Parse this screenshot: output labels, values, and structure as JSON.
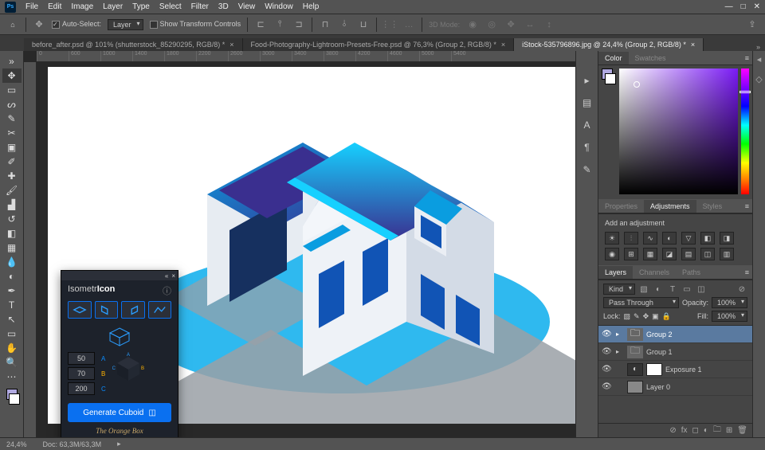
{
  "app": {
    "logo": "Ps"
  },
  "menu": [
    "File",
    "Edit",
    "Image",
    "Layer",
    "Type",
    "Select",
    "Filter",
    "3D",
    "View",
    "Window",
    "Help"
  ],
  "options": {
    "auto_select": "Auto-Select:",
    "auto_select_mode": "Layer",
    "show_transform": "Show Transform Controls",
    "mode_3d": "3D Mode:"
  },
  "tabs": [
    {
      "label": "before_after.psd @ 101% (shutterstock_85290295, RGB/8) *",
      "active": false
    },
    {
      "label": "Food-Photography-Lightroom-Presets-Free.psd @ 76,3% (Group 2, RGB/8) *",
      "active": false
    },
    {
      "label": "iStock-535796896.jpg @ 24,4% (Group 2, RGB/8) *",
      "active": true
    }
  ],
  "ruler": [
    "0",
    "600",
    "1000",
    "1400",
    "1800",
    "2200",
    "2600",
    "3000",
    "3400",
    "3800",
    "4200",
    "4600",
    "5000",
    "5400"
  ],
  "plugin": {
    "title_pre": "Isometr",
    "title_bold": "Icon",
    "vals": {
      "a": "50",
      "b": "70",
      "c": "200"
    },
    "axes": {
      "a": "A",
      "b": "B",
      "c": "C"
    },
    "generate": "Generate Cuboid",
    "signature": "The Orange Box"
  },
  "colorpanel": {
    "tab_color": "Color",
    "tab_swatches": "Swatches"
  },
  "adjustments": {
    "tab_props": "Properties",
    "tab_adj": "Adjustments",
    "tab_styles": "Styles",
    "label": "Add an adjustment"
  },
  "layerspanel": {
    "tab_layers": "Layers",
    "tab_channels": "Channels",
    "tab_paths": "Paths",
    "kind": "Kind",
    "blend": "Pass Through",
    "opacity_label": "Opacity:",
    "opacity": "100%",
    "lock_label": "Lock:",
    "fill_label": "Fill:",
    "fill": "100%",
    "rows": [
      {
        "name": "Group 2",
        "type": "folder",
        "selected": true
      },
      {
        "name": "Group 1",
        "type": "folder",
        "selected": false
      },
      {
        "name": "Exposure 1",
        "type": "adjustment",
        "selected": false
      },
      {
        "name": "Layer 0",
        "type": "layer",
        "selected": false
      }
    ]
  },
  "status": {
    "zoom": "24,4%",
    "doc": "Doc: 63,3M/63,3M"
  }
}
